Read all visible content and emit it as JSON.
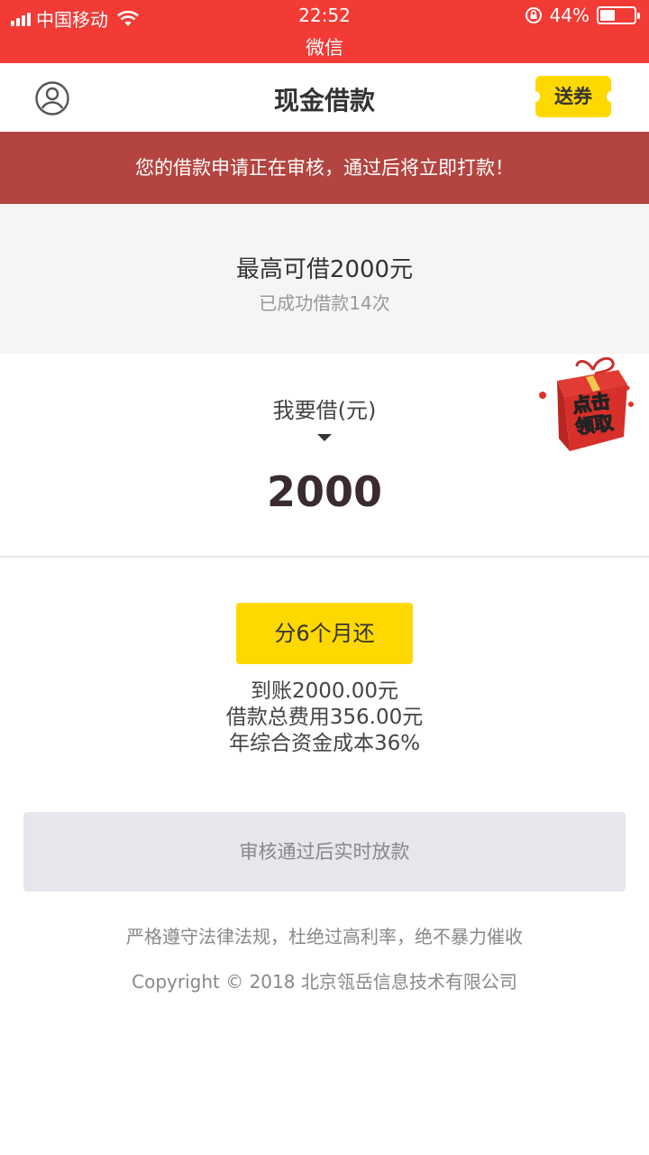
{
  "status_bar": {
    "carrier": "中国移动",
    "time": "22:52",
    "battery_text": "44%",
    "battery_level": 0.44,
    "app_name": "微信"
  },
  "nav": {
    "title": "现金借款",
    "coupon_label": "送券",
    "icons": [
      "user-icon"
    ]
  },
  "notice": {
    "text": "您的借款申请正在审核，通过后将立即打款！"
  },
  "limit": {
    "title": "最高可借2000元",
    "subtitle": "已成功借款14次"
  },
  "amount": {
    "label": "我要借(元)",
    "value": "2000"
  },
  "gift": {
    "text_line1": "点击",
    "text_line2": "领取"
  },
  "plan": {
    "term_label": "分6个月还",
    "received": "到账2000.00元",
    "total_fee": "借款总费用356.00元",
    "annual_cost": "年综合资金成本36%"
  },
  "submit": {
    "label": "审核通过后实时放款"
  },
  "footer": {
    "note": "严格遵守法律法规，杜绝过高利率，绝不暴力催收",
    "copyright": "Copyright © 2018 北京瓴岳信息技术有限公司"
  },
  "colors": {
    "status_bar": "#f23b35",
    "notice_bg": "#b3443f",
    "accent_yellow": "#ffd800"
  }
}
